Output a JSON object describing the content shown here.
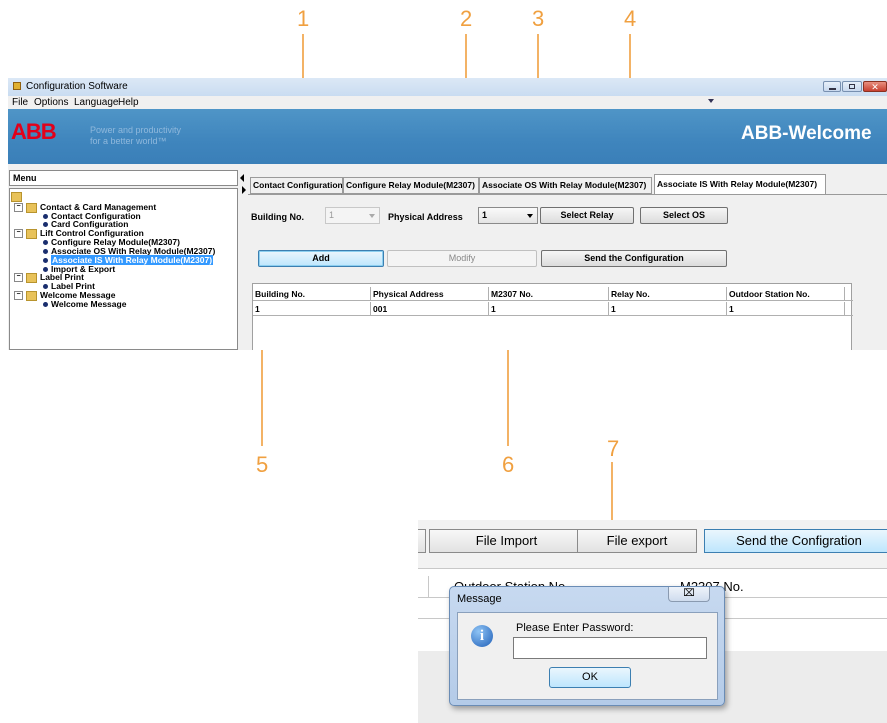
{
  "callouts": [
    "1",
    "2",
    "3",
    "4",
    "5",
    "6",
    "7"
  ],
  "window": {
    "title": "Configuration Software",
    "menu": [
      "File",
      "Options",
      "Language",
      "Help"
    ],
    "banner": {
      "logo": "ABB",
      "tagline1": "Power and productivity",
      "tagline2": "for a better world™",
      "brand": "ABB-Welcome"
    }
  },
  "sidebar": {
    "title": "Menu",
    "items": [
      {
        "label": "Contact & Card Management",
        "kind": "folder"
      },
      {
        "label": "Contact Configuration",
        "kind": "leaf"
      },
      {
        "label": "Card Configuration",
        "kind": "leaf"
      },
      {
        "label": "Lift Control Configuration",
        "kind": "folder"
      },
      {
        "label": "Configure Relay Module(M2307)",
        "kind": "leaf"
      },
      {
        "label": "Associate OS With Relay Module(M2307)",
        "kind": "leaf"
      },
      {
        "label": "Associate IS With Relay Module(M2307)",
        "kind": "leaf",
        "selected": true
      },
      {
        "label": "Import & Export",
        "kind": "leaf"
      },
      {
        "label": "Label Print",
        "kind": "folder"
      },
      {
        "label": "Label Print",
        "kind": "leaf"
      },
      {
        "label": "Welcome Message",
        "kind": "folder"
      },
      {
        "label": "Welcome Message",
        "kind": "leaf"
      }
    ]
  },
  "tabs": [
    "Contact Configuration",
    "Configure Relay Module(M2307)",
    "Associate OS With Relay Module(M2307)",
    "Associate IS With Relay Module(M2307)"
  ],
  "form": {
    "building_label": "Building No.",
    "building_value": "1",
    "physical_label": "Physical Address",
    "physical_value": "1",
    "select_relay": "Select Relay",
    "select_os": "Select OS",
    "add": "Add",
    "modify": "Modify",
    "send": "Send the Configuration"
  },
  "table": {
    "headers": [
      "Building No.",
      "Physical Address",
      "M2307 No.",
      "Relay No.",
      "Outdoor Station No."
    ],
    "rows": [
      [
        "1",
        "001",
        "1",
        "1",
        "1"
      ]
    ]
  },
  "bottom": {
    "file_import": "File Import",
    "file_export": "File export",
    "send_config": "Send the Configration",
    "col_outdoor": "Outdoor Station No.",
    "col_m2307": "M2307 No.",
    "dialog": {
      "title": "Message",
      "close": "⌧",
      "prompt": "Please Enter Password:",
      "password": "",
      "ok": "OK"
    }
  },
  "colors": {
    "callout": "#f0a040",
    "banner": "#3f85bd",
    "selected": "#3399ff",
    "abb_red": "#e2001a"
  }
}
